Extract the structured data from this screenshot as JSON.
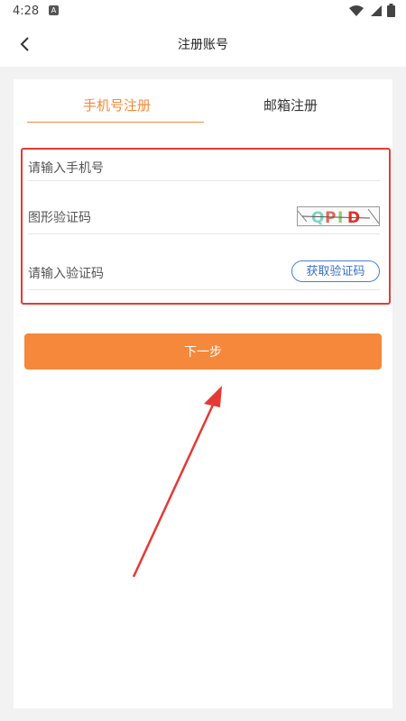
{
  "status_bar": {
    "time": "4:28"
  },
  "app_bar": {
    "title": "注册账号",
    "back_icon": "chevron-left-icon"
  },
  "tabs": [
    {
      "label": "手机号注册",
      "active": true
    },
    {
      "label": "邮箱注册",
      "active": false
    }
  ],
  "form": {
    "phone_placeholder": "请输入手机号",
    "captcha_label": "图形验证码",
    "captcha_text": "QPID",
    "code_placeholder": "请输入验证码",
    "get_code_label": "获取验证码"
  },
  "next_button": {
    "label": "下一步"
  },
  "colors": {
    "accent": "#f5883a",
    "link_blue": "#3a6fc6",
    "highlight_red": "#e53935"
  }
}
